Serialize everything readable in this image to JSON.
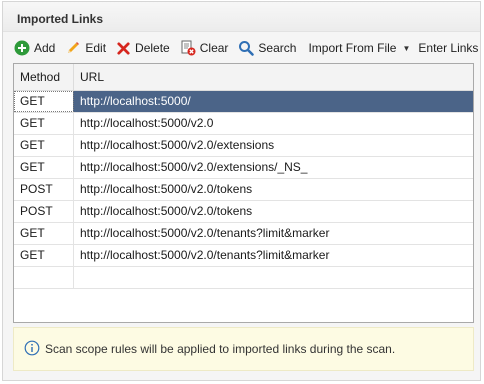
{
  "panel": {
    "title": "Imported Links"
  },
  "toolbar": {
    "add": "Add",
    "edit": "Edit",
    "delete": "Delete",
    "clear": "Clear",
    "search": "Search",
    "import_from_file": "Import From File",
    "enter_links": "Enter Links"
  },
  "table": {
    "columns": [
      "Method",
      "URL"
    ],
    "selected_row": 0,
    "rows": [
      {
        "method": "GET",
        "url": "http://localhost:5000/"
      },
      {
        "method": "GET",
        "url": "http://localhost:5000/v2.0"
      },
      {
        "method": "GET",
        "url": "http://localhost:5000/v2.0/extensions"
      },
      {
        "method": "GET",
        "url": "http://localhost:5000/v2.0/extensions/_NS_"
      },
      {
        "method": "POST",
        "url": "http://localhost:5000/v2.0/tokens"
      },
      {
        "method": "POST",
        "url": "http://localhost:5000/v2.0/tokens"
      },
      {
        "method": "GET",
        "url": "http://localhost:5000/v2.0/tenants?limit&marker"
      },
      {
        "method": "GET",
        "url": "http://localhost:5000/v2.0/tenants?limit&marker"
      },
      {
        "method": "",
        "url": ""
      }
    ]
  },
  "info": {
    "message": "Scan scope rules will be applied to imported links during the scan."
  },
  "colors": {
    "selected_row": "#4b6488",
    "add_icon": "#2e9a3a",
    "delete_icon": "#d6261e",
    "search_icon": "#2f6fb5",
    "info_background": "#fdfbe3"
  }
}
